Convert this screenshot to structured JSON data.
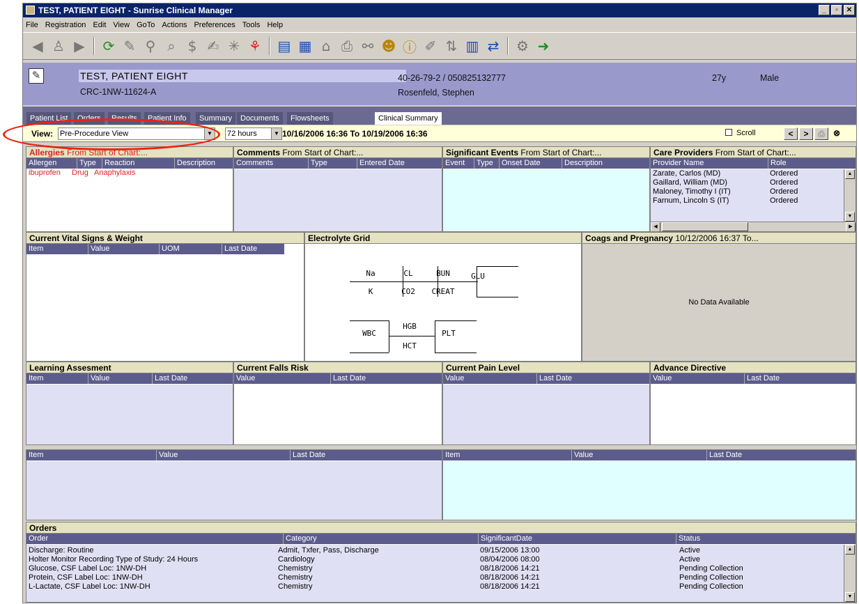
{
  "window": {
    "title": "TEST, PATIENT EIGHT - Sunrise Clinical Manager",
    "controls": [
      "_",
      "▫",
      "✕"
    ]
  },
  "menu": [
    "File",
    "Registration",
    "Edit",
    "View",
    "GoTo",
    "Actions",
    "Preferences",
    "Tools",
    "Help"
  ],
  "toolbar_icons": [
    "back-arrow-icon",
    "people-icon",
    "forward-arrow-icon",
    "refresh-icon",
    "edit-chart-icon",
    "search-icon",
    "zoom-icon",
    "dollar-icon",
    "write-icon",
    "star-icon",
    "person-icon",
    "list-icon",
    "chart-icon",
    "building-icon",
    "printer-icon",
    "link-icon",
    "user-send-icon",
    "info-icon",
    "pin-icon",
    "sort-icon",
    "calendar-icon",
    "arrows-icon",
    "tools-icon",
    "exit-icon"
  ],
  "patient": {
    "name": "TEST, PATIENT EIGHT",
    "location": "CRC-1NW-11624-A",
    "ids": "40-26-79-2 / 050825132777",
    "physician": "Rosenfeld, Stephen",
    "age": "27y",
    "sex": "Male"
  },
  "tabs": [
    "Patient List",
    "Orders",
    "Results",
    "Patient Info",
    "Summary",
    "Documents",
    "Flowsheets",
    "Clinical Summary"
  ],
  "active_tab": "Clinical Summary",
  "viewbar": {
    "label": "View:",
    "view": "Pre-Procedure View",
    "period": "72 hours",
    "range": "10/16/2006 16:36 To 10/19/2006 16:36",
    "scroll": "Scroll",
    "prev": "<",
    "next": ">"
  },
  "allergies": {
    "title": "Allergies",
    "sub": "From Start of Chart:...",
    "cols": [
      "Allergen",
      "Type",
      "Reaction",
      "Description"
    ],
    "rows": [
      [
        "ibuprofen",
        "Drug",
        "Anaphylaxis",
        ""
      ]
    ]
  },
  "comments": {
    "title": "Comments",
    "sub": "From Start of Chart:...",
    "cols": [
      "Comments",
      "Type",
      "Entered Date"
    ]
  },
  "events": {
    "title": "Significant Events",
    "sub": "From Start of Chart:...",
    "cols": [
      "Event",
      "Type",
      "Onset Date",
      "Description"
    ]
  },
  "providers": {
    "title": "Care Providers",
    "sub": "From Start of Chart:...",
    "cols": [
      "Provider Name",
      "Role"
    ],
    "rows": [
      [
        "Zarate, Carlos (MD)",
        "Ordered"
      ],
      [
        "Gaillard, William (MD)",
        "Ordered"
      ],
      [
        "Maloney, Timothy I (IT)",
        "Ordered"
      ],
      [
        "Farnum, Lincoln S (IT)",
        "Ordered"
      ]
    ]
  },
  "vitals": {
    "title": "Current Vital Signs & Weight",
    "cols": [
      "Item",
      "Value",
      "UOM",
      "Last Date"
    ]
  },
  "electrolyte": {
    "title": "Electrolyte Grid",
    "na": "Na",
    "cl": "CL",
    "bun": "BUN",
    "glu": "GLU",
    "k": "K",
    "co2": "CO2",
    "creat": "CREAT",
    "wbc": "WBC",
    "hgb": "HGB",
    "plt": "PLT",
    "hct": "HCT"
  },
  "coags": {
    "title": "Coags and Pregnancy",
    "sub": "10/12/2006 16:37 To...",
    "empty": "No Data Available"
  },
  "learning": {
    "title": "Learning Assesment",
    "cols": [
      "Item",
      "Value",
      "Last Date"
    ]
  },
  "falls": {
    "title": "Current Falls Risk",
    "cols": [
      "Value",
      "Last Date"
    ]
  },
  "pain": {
    "title": "Current Pain Level",
    "cols": [
      "Value",
      "Last Date"
    ]
  },
  "directive": {
    "title": "Advance Directive",
    "cols": [
      "Value",
      "Last Date"
    ]
  },
  "misc_left": {
    "cols": [
      "Item",
      "Value",
      "Last Date"
    ]
  },
  "misc_right": {
    "cols": [
      "Item",
      "Value",
      "Last Date"
    ]
  },
  "orders": {
    "title": "Orders",
    "cols": [
      "Order",
      "Category",
      "SignificantDate",
      "Status"
    ],
    "rows": [
      [
        "Discharge:  Routine",
        "Admit, Txfer, Pass, Discharge",
        "09/15/2006 13:00",
        "Active"
      ],
      [
        "Holter Monitor Recording  Type of Study: 24 Hours",
        "Cardiology",
        "08/04/2006 08:00",
        "Active"
      ],
      [
        "Glucose, CSF  Label Loc: 1NW-DH",
        "Chemistry",
        "08/18/2006 14:21",
        "Pending Collection"
      ],
      [
        "Protein, CSF  Label Loc: 1NW-DH",
        "Chemistry",
        "08/18/2006 14:21",
        "Pending Collection"
      ],
      [
        "L-Lactate, CSF  Label Loc: 1NW-DH",
        "Chemistry",
        "08/18/2006 14:21",
        "Pending Collection"
      ]
    ]
  },
  "colors": {
    "banner": "#9999cc",
    "header": "#5c5c8c",
    "panel_title": "#e5e2c1",
    "highlight": "#e21"
  }
}
